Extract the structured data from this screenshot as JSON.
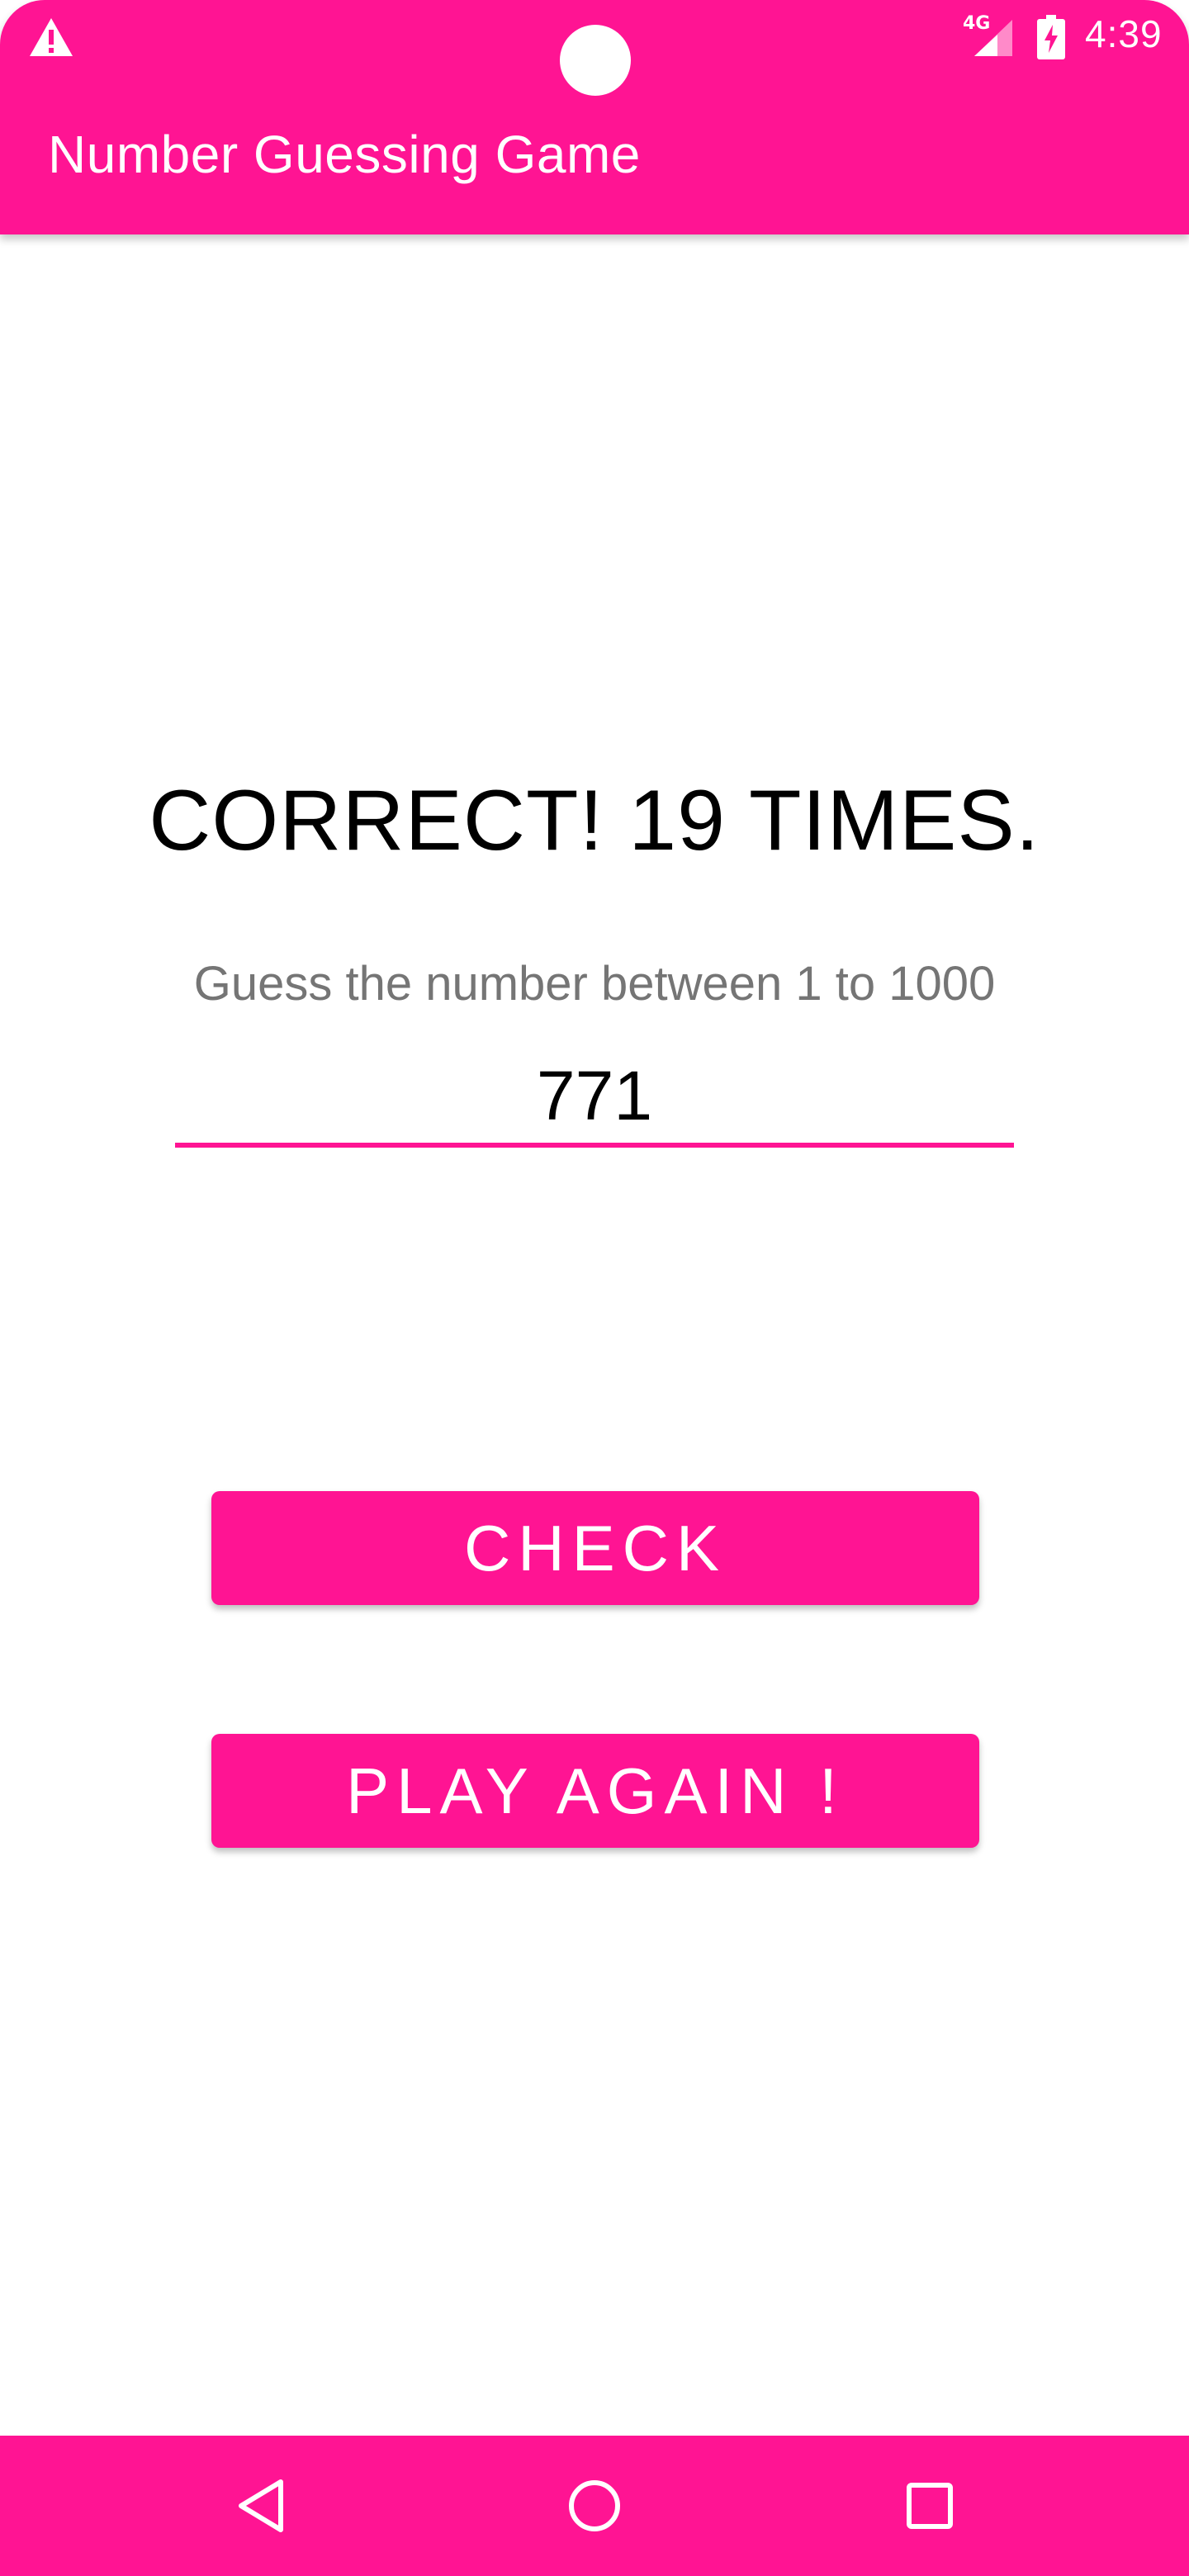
{
  "status_bar": {
    "time": "4:39",
    "network": "4G",
    "icons": [
      "warning-icon",
      "signal-icon",
      "battery-charging-icon"
    ]
  },
  "app_bar": {
    "title": "Number Guessing Game"
  },
  "game": {
    "result": "CORRECT! 19 TIMES.",
    "hint": "Guess the number between 1 to 1000",
    "guess_value": "771"
  },
  "buttons": {
    "check_label": "CHECK",
    "play_again_label": "PLAY AGAIN !"
  },
  "nav_bar": {
    "icons": [
      "back-icon",
      "home-icon",
      "recents-icon"
    ]
  },
  "colors": {
    "primary": "#ff1493",
    "text": "#000000",
    "hint": "#757575",
    "background": "#ffffff"
  }
}
